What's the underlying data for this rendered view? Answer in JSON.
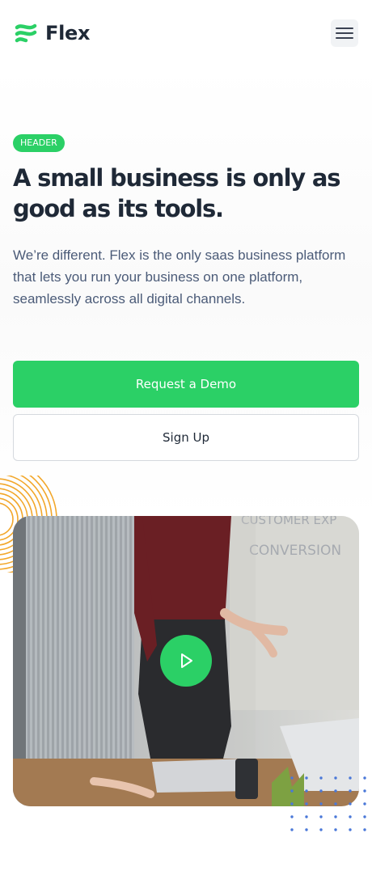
{
  "brand": {
    "name": "Flex",
    "logo_icon": "flex-logo-icon"
  },
  "nav": {
    "menu_icon": "hamburger-menu-icon"
  },
  "hero": {
    "badge": "HEADER",
    "title": "A small business is only as good as its tools.",
    "description": "We’re different. Flex is the only saas business platform that lets you run your business on one platform, seamlessly across all digital channels.",
    "primary_cta": "Request a Demo",
    "secondary_cta": "Sign Up"
  },
  "video": {
    "play_icon": "play-icon",
    "whiteboard_text": [
      "CUSTOMER EXP",
      "CONVERSION"
    ]
  },
  "colors": {
    "accent": "#2bd066",
    "heading": "#1f2937",
    "body_text": "#4b5b78",
    "decoration_orange": "#f2a72b",
    "decoration_blue": "#4a78d8"
  }
}
